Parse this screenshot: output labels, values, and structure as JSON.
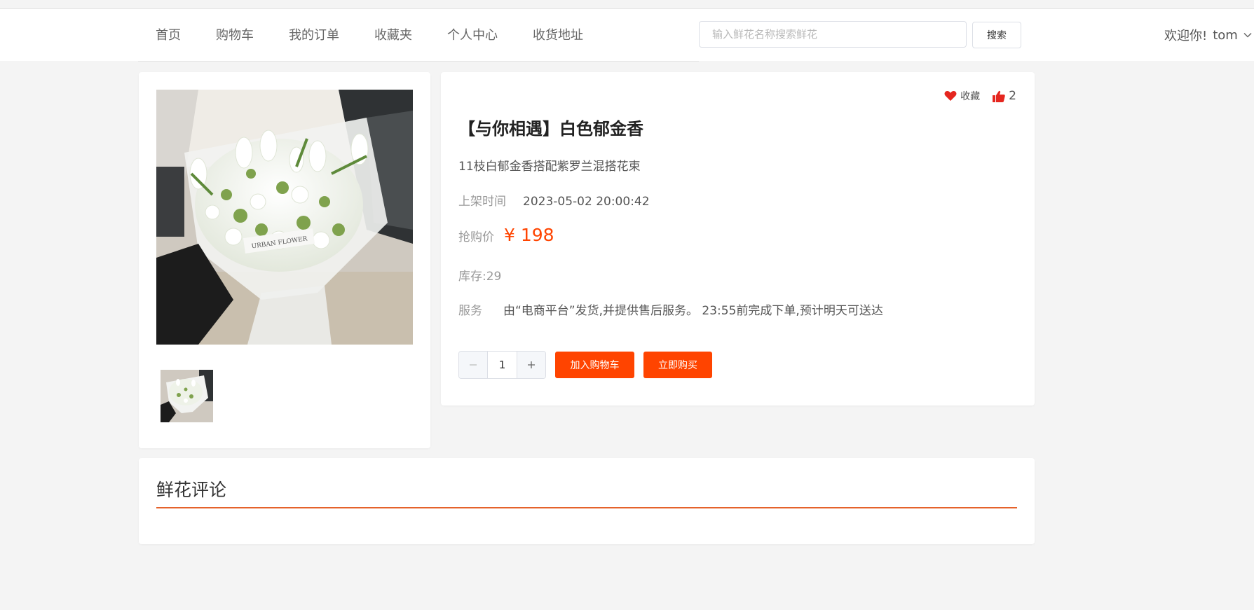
{
  "nav": {
    "items": [
      {
        "label": "首页"
      },
      {
        "label": "购物车"
      },
      {
        "label": "我的订单"
      },
      {
        "label": "收藏夹"
      },
      {
        "label": "个人中心"
      },
      {
        "label": "收货地址"
      }
    ]
  },
  "search": {
    "placeholder": "输入鲜花名称搜索鲜花",
    "value": "",
    "button_label": "搜索"
  },
  "user": {
    "welcome": "欢迎你!",
    "name": "tom",
    "dropdown_icon": "chevron-down-icon"
  },
  "product": {
    "title": "【与你相遇】白色郁金香",
    "description": "11枝白郁金香搭配紫罗兰混搭花束",
    "time_label": "上架时间",
    "time_value": "2023-05-02 20:00:42",
    "price_label": "抢购价",
    "price_value": "¥ 198",
    "stock_text": "库存:29",
    "service_label": "服务",
    "service_value": "由“电商平台”发货,并提供售后服务。 23:55前完成下单,预计明天可送达",
    "favorite_label": "收藏",
    "like_count": "2",
    "quantity": "1",
    "add_to_cart_label": "加入购物车",
    "buy_now_label": "立即购买",
    "photo_wrap_text": "URBAN FLOWER"
  },
  "comments": {
    "title": "鲜花评论"
  },
  "colors": {
    "accent": "#ff4400",
    "heart": "#e5261f",
    "comment_line": "#e5622b",
    "background": "#f4f4f4"
  }
}
